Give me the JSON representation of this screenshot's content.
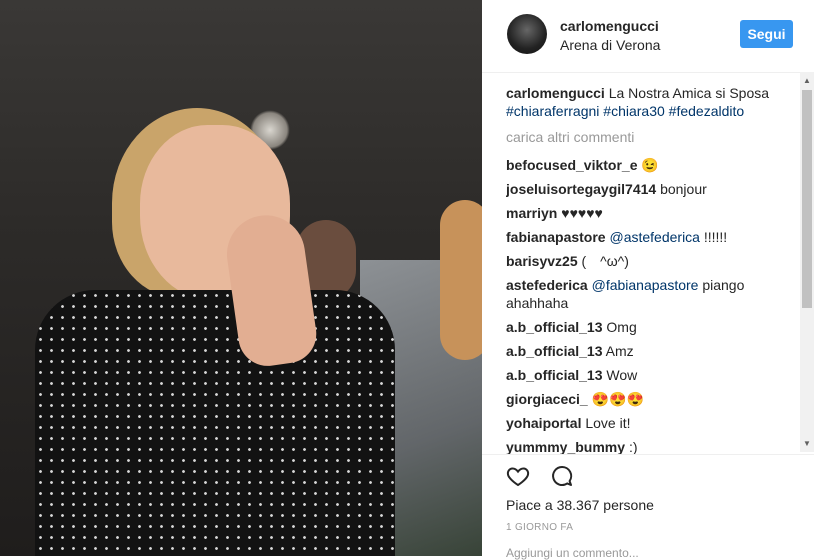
{
  "post": {
    "username": "carlomengucci",
    "location": "Arena di Verona",
    "follow_label": "Segui",
    "caption": {
      "user": "carlomengucci",
      "text": "La Nostra Amica si Sposa",
      "hashtags": [
        "#chiaraferragni",
        "#chiara30",
        "#fedezaldito"
      ]
    },
    "load_more": "carica altri commenti",
    "comments": [
      {
        "user": "befocused_viktor_e",
        "text": "😉",
        "mention": ""
      },
      {
        "user": "joseluisortegaygil7414",
        "text": "bonjour",
        "mention": ""
      },
      {
        "user": "marriyn",
        "text": "♥♥♥♥♥",
        "mention": ""
      },
      {
        "user": "fabianapastore",
        "mention": "@astefederica",
        "text": " !!!!!!"
      },
      {
        "user": "barisyvz25",
        "text": "(　^ω^)",
        "mention": ""
      },
      {
        "user": "astefederica",
        "mention": "@fabianapastore",
        "text": " piango ahahhaha"
      },
      {
        "user": "a.b_official_13",
        "text": "Omg",
        "mention": ""
      },
      {
        "user": "a.b_official_13",
        "text": "Amz",
        "mention": ""
      },
      {
        "user": "a.b_official_13",
        "text": "Wow",
        "mention": ""
      },
      {
        "user": "giorgiaceci_",
        "text": "😍😍😍",
        "mention": ""
      },
      {
        "user": "yohaiportal",
        "text": "Love it!",
        "mention": ""
      },
      {
        "user": "yummmy_bummy",
        "text": ":)",
        "mention": ""
      }
    ],
    "likes_text": "Piace a 38.367 persone",
    "timestamp": "1 GIORNO FA",
    "add_comment_placeholder": "Aggiungi un commento..."
  },
  "icons": {
    "like": "heart-icon",
    "comment": "comment-icon"
  },
  "colors": {
    "follow_button": "#3897f0",
    "hashtag": "#003569",
    "muted": "#999999"
  }
}
